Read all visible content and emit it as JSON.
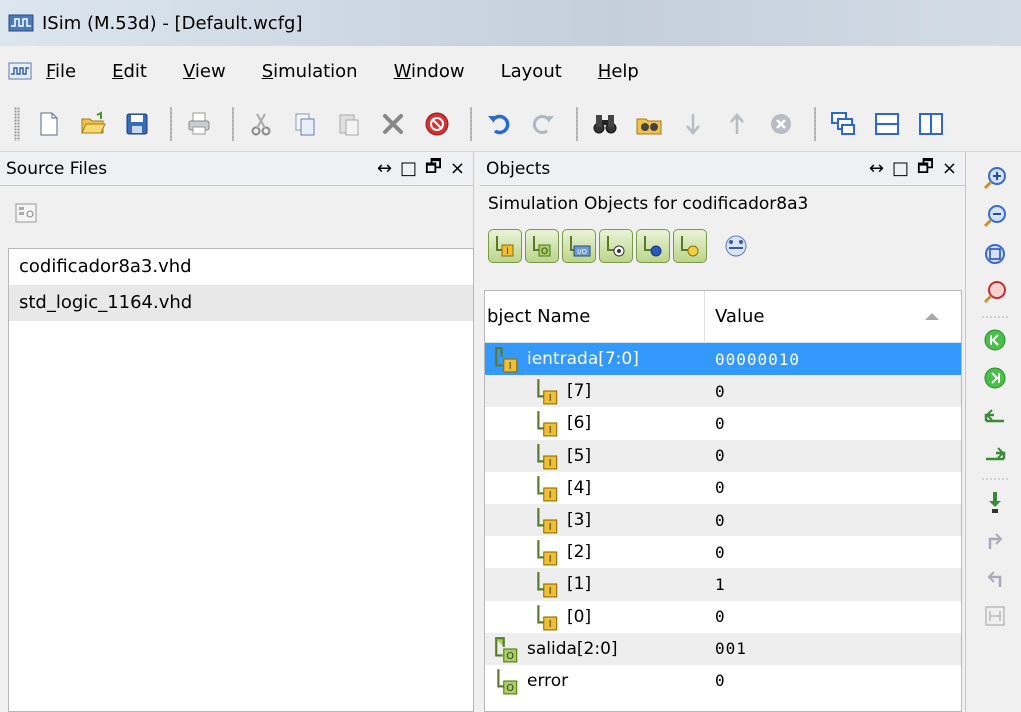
{
  "window": {
    "title": "ISim (M.53d) - [Default.wcfg]"
  },
  "menu": [
    {
      "label": "File",
      "u": "F",
      "rest": "ile"
    },
    {
      "label": "Edit",
      "u": "E",
      "rest": "dit"
    },
    {
      "label": "View",
      "u": "V",
      "rest": "iew"
    },
    {
      "label": "Simulation",
      "u": "S",
      "rest": "imulation"
    },
    {
      "label": "Window",
      "u": "W",
      "rest": "indow"
    },
    {
      "label": "Layout",
      "u": "",
      "rest": "Layout"
    },
    {
      "label": "Help",
      "u": "H",
      "rest": "elp"
    }
  ],
  "source_panel": {
    "title": "Source Files",
    "files": [
      "codificador8a3.vhd",
      "std_logic_1164.vhd"
    ]
  },
  "objects_panel": {
    "title": "Objects",
    "subtitle": "Simulation Objects for codificador8a3",
    "col_name": "bject Name",
    "col_value": "Value",
    "rows": [
      {
        "name": "ientrada[7:0]",
        "value": "00000010",
        "kind": "bus-in"
      },
      {
        "name": "[7]",
        "value": "0",
        "kind": "bit-in"
      },
      {
        "name": "[6]",
        "value": "0",
        "kind": "bit-in"
      },
      {
        "name": "[5]",
        "value": "0",
        "kind": "bit-in"
      },
      {
        "name": "[4]",
        "value": "0",
        "kind": "bit-in"
      },
      {
        "name": "[3]",
        "value": "0",
        "kind": "bit-in"
      },
      {
        "name": "[2]",
        "value": "0",
        "kind": "bit-in"
      },
      {
        "name": "[1]",
        "value": "1",
        "kind": "bit-in"
      },
      {
        "name": "[0]",
        "value": "0",
        "kind": "bit-in"
      },
      {
        "name": "salida[2:0]",
        "value": "001",
        "kind": "bus-out"
      },
      {
        "name": "error",
        "value": "0",
        "kind": "bit-out"
      }
    ]
  },
  "panel_controls": {
    "move": "↔",
    "restore": "□",
    "float": "🗗",
    "close": "×"
  },
  "colors": {
    "selection": "#3399ff",
    "accent_green": "#8ab44a"
  }
}
